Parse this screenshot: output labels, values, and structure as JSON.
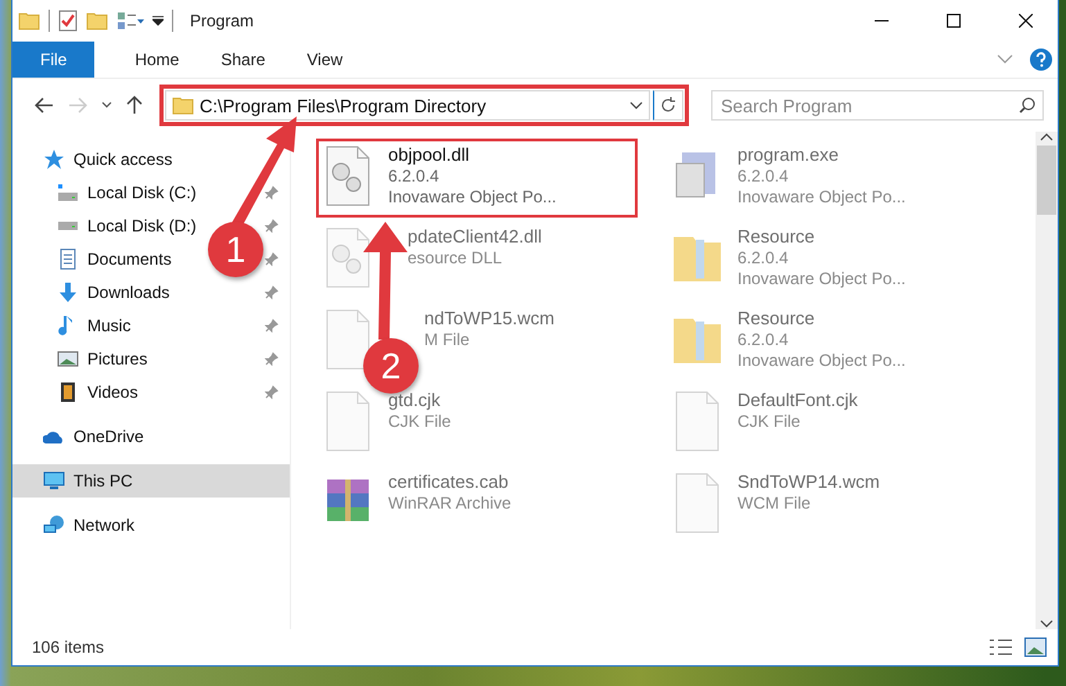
{
  "window": {
    "title": "Program"
  },
  "ribbon_tabs": [
    {
      "label": "File",
      "selected": true
    },
    {
      "label": "Home",
      "selected": false
    },
    {
      "label": "Share",
      "selected": false
    },
    {
      "label": "View",
      "selected": false
    }
  ],
  "address_bar": {
    "path": "C:\\Program Files\\Program Directory",
    "highlighted": true
  },
  "search": {
    "placeholder": "Search Program"
  },
  "sidebar": {
    "items": [
      {
        "label": "Quick access",
        "selected": false,
        "children": [
          {
            "label": "Local Disk (C:)",
            "selected": false,
            "pinned": true
          },
          {
            "label": "Local Disk (D:)",
            "selected": false,
            "pinned": true
          },
          {
            "label": "Documents",
            "selected": false,
            "pinned": true
          },
          {
            "label": "Downloads",
            "selected": false,
            "pinned": true
          },
          {
            "label": "Music",
            "selected": false,
            "pinned": true
          },
          {
            "label": "Pictures",
            "selected": false,
            "pinned": true
          },
          {
            "label": "Videos",
            "selected": false,
            "pinned": true
          }
        ]
      },
      {
        "label": "OneDrive",
        "selected": false
      },
      {
        "label": "This PC",
        "selected": true
      },
      {
        "label": "Network",
        "selected": false
      }
    ]
  },
  "files": [
    {
      "name": "objpool.dll",
      "details": [
        "6.2.0.4",
        "Inovaware Object Po..."
      ],
      "highlighted": true,
      "blurred": false
    },
    {
      "name": "program.exe",
      "details": [
        "6.2.0.4",
        "Inovaware Object Po..."
      ],
      "highlighted": false,
      "blurred": true
    },
    {
      "name": "pdateClient42.dll",
      "details": [
        "esource DLL"
      ],
      "highlighted": false,
      "blurred": true
    },
    {
      "name": "Resource",
      "details": [
        "6.2.0.4",
        "Inovaware Object Po..."
      ],
      "highlighted": false,
      "blurred": true
    },
    {
      "name": "ndToWP15.wcm",
      "details": [
        "M File"
      ],
      "highlighted": false,
      "blurred": true
    },
    {
      "name": "Resource",
      "details": [
        "6.2.0.4",
        "Inovaware Object Po..."
      ],
      "highlighted": false,
      "blurred": true
    },
    {
      "name": "gtd.cjk",
      "details": [
        "CJK File"
      ],
      "highlighted": false,
      "blurred": true
    },
    {
      "name": "DefaultFont.cjk",
      "details": [
        "CJK File"
      ],
      "highlighted": false,
      "blurred": true
    },
    {
      "name": "certificates.cab",
      "details": [
        "WinRAR Archive"
      ],
      "highlighted": false,
      "blurred": true
    },
    {
      "name": "SndToWP14.wcm",
      "details": [
        "WCM File"
      ],
      "highlighted": false,
      "blurred": true
    }
  ],
  "status_bar": {
    "count": "106 items"
  },
  "annotations": [
    {
      "label": "1"
    },
    {
      "label": "2"
    }
  ]
}
